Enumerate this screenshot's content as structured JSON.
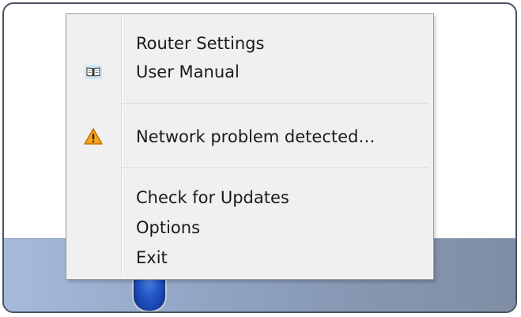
{
  "menu": {
    "items": [
      {
        "label": "Router Settings",
        "icon": "none"
      },
      {
        "label": "User Manual",
        "icon": "book-icon"
      },
      {
        "label": "Network problem detected…",
        "icon": "warning-icon"
      },
      {
        "label": "Check for Updates",
        "icon": "none"
      },
      {
        "label": "Options",
        "icon": "none"
      },
      {
        "label": "Exit",
        "icon": "none"
      }
    ]
  },
  "colors": {
    "menu_background": "#f0f0f0",
    "warning_accent": "#f5a31a",
    "taskbar": "#93a7c6",
    "tray_icon": "#2457c9"
  }
}
